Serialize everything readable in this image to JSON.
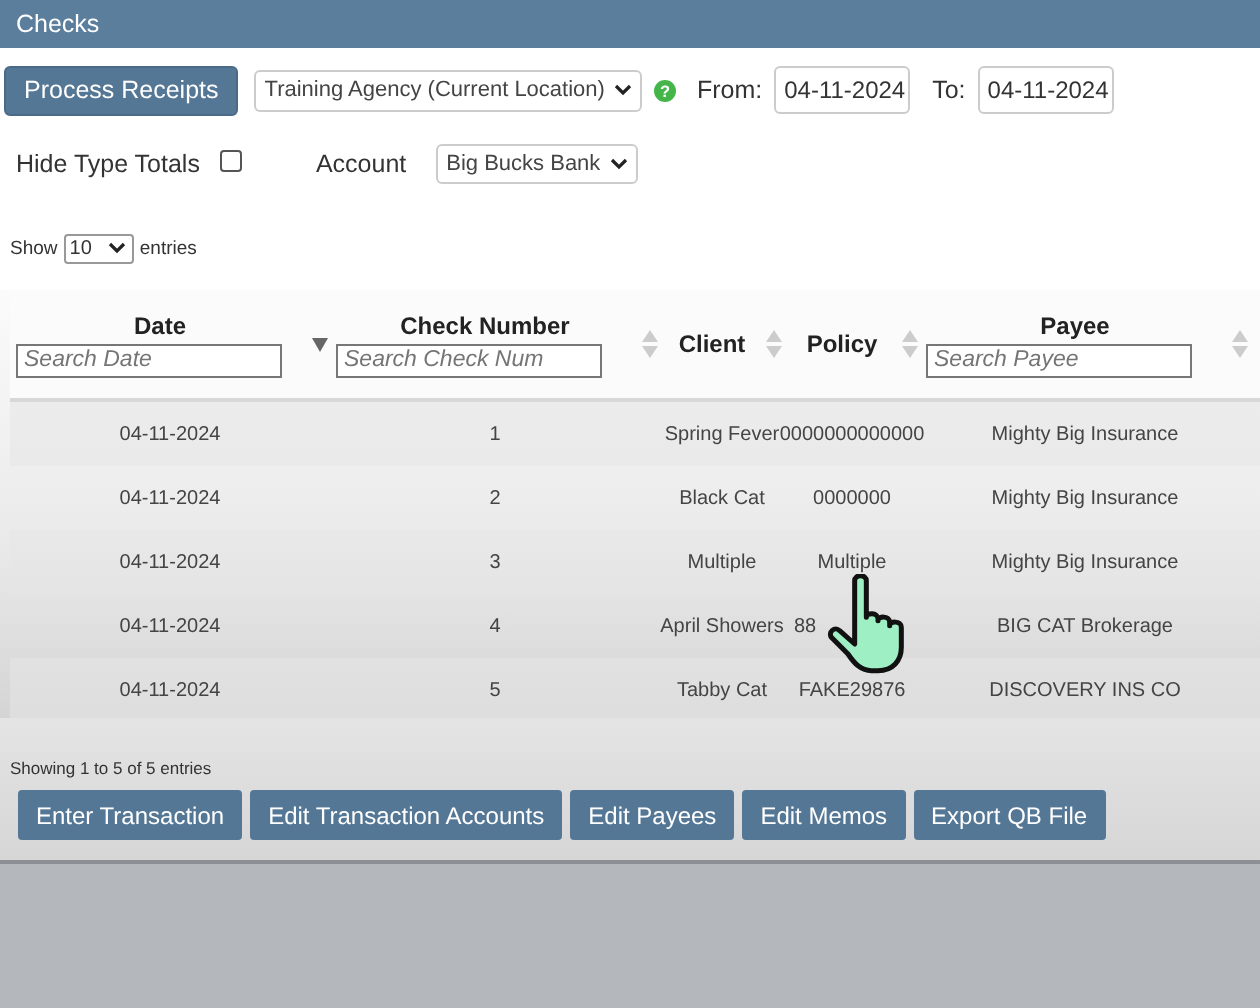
{
  "window": {
    "title": "Checks"
  },
  "toolbar": {
    "process_button": "Process Receipts",
    "location": "Training Agency (Current Location)",
    "help_icon": "?",
    "from_label": "From:",
    "from_value": "04-11-2024",
    "to_label": "To:",
    "to_value": "04-11-2024"
  },
  "options": {
    "hide_totals_label": "Hide Type Totals",
    "hide_totals_checked": false,
    "account_label": "Account",
    "account_value": "Big Bucks Bank"
  },
  "length": {
    "show": "Show",
    "value": "10",
    "entries": "entries"
  },
  "table": {
    "columns": [
      {
        "label": "Date",
        "placeholder": "Search Date",
        "sorted": true
      },
      {
        "label": "Check Number",
        "placeholder": "Search Check Num",
        "sorted": false
      },
      {
        "label": "Client",
        "sorted": false
      },
      {
        "label": "Policy",
        "sorted": false
      },
      {
        "label": "Payee",
        "placeholder": "Search Payee",
        "sorted": false
      }
    ],
    "rows": [
      [
        "04-11-2024",
        "1",
        "Spring Fever",
        "0000000000000",
        "Mighty Big Insurance"
      ],
      [
        "04-11-2024",
        "2",
        "Black Cat",
        "0000000",
        "Mighty Big Insurance"
      ],
      [
        "04-11-2024",
        "3",
        "Multiple",
        "Multiple",
        "Mighty Big Insurance"
      ],
      [
        "04-11-2024",
        "4",
        "April Showers",
        "88",
        "BIG CAT Brokerage"
      ],
      [
        "04-11-2024",
        "5",
        "Tabby Cat",
        "FAKE29876",
        "DISCOVERY INS CO"
      ]
    ]
  },
  "info": "Showing 1 to 5 of 5 entries",
  "buttons": [
    "Enter Transaction",
    "Edit Transaction Accounts",
    "Edit Payees",
    "Edit Memos",
    "Export QB File"
  ]
}
